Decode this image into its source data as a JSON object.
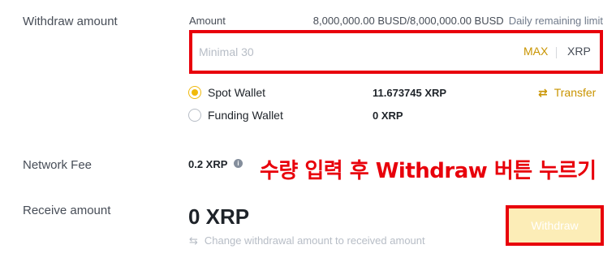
{
  "withdraw_amount": {
    "label": "Withdraw amount",
    "amount_label": "Amount",
    "limit_value": "8,000,000.00 BUSD/8,000,000.00 BUSD",
    "limit_label": "Daily remaining limit",
    "placeholder": "Minimal 30",
    "max_label": "MAX",
    "coin": "XRP"
  },
  "wallets": [
    {
      "label": "Spot Wallet",
      "balance": "11.673745 XRP",
      "selected": true
    },
    {
      "label": "Funding Wallet",
      "balance": "0 XRP",
      "selected": false
    }
  ],
  "transfer_label": "Transfer",
  "network_fee": {
    "label": "Network Fee",
    "value": "0.2 XRP",
    "info_icon": "info-icon"
  },
  "annotation": "수량 입력 후 Withdraw 버튼 누르기",
  "receive": {
    "label": "Receive amount",
    "value": "0 XRP",
    "change_link": "Change withdrawal amount to received amount"
  },
  "withdraw_button": "Withdraw",
  "colors": {
    "accent": "#f0b90b",
    "link": "#c99400",
    "highlight_border": "#e8000b",
    "button_disabled_bg": "#fcedb7"
  }
}
